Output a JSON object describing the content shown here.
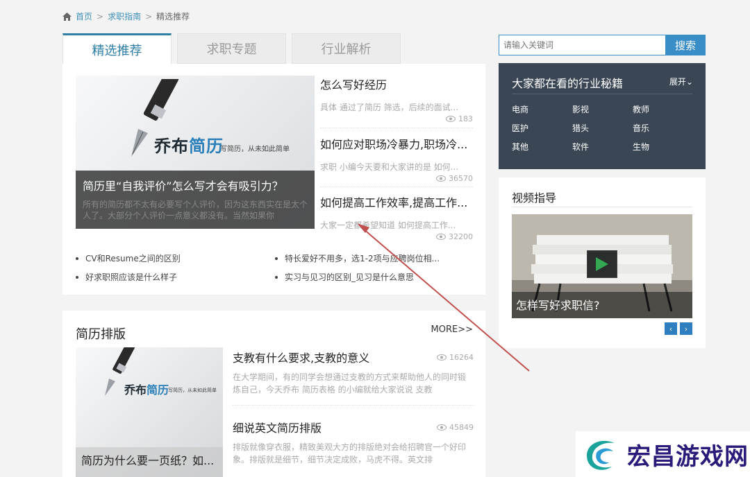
{
  "breadcrumb": {
    "home": "首页",
    "sep1": ">",
    "guide": "求职指南",
    "sep2": ">",
    "current": "精选推荐"
  },
  "tabs": [
    {
      "label": "精选推荐",
      "active": true
    },
    {
      "label": "求职专题",
      "active": false
    },
    {
      "label": "行业解析",
      "active": false
    }
  ],
  "featured": {
    "brand_part1": "乔布",
    "brand_part2": "简历",
    "brand_sub": "写简历，从未如此简单",
    "title": "简历里“自我评价”怎么写才会有吸引力？",
    "desc": "所有的简历都不太有必要写个人评价，因为这东西实在是太个人了。大部分个人评价一点意义都没有。当然如果你"
  },
  "articles": [
    {
      "title": "怎么写好经历",
      "desc": "具体 通过了简历 筛选，后续的面试...",
      "views": "183"
    },
    {
      "title": "如何应对职场冷暴力,职场冷...",
      "desc": "求职 小编今天要和大家讲的是 如何...",
      "views": "36570"
    },
    {
      "title": "如何提高工作效率,提高工作...",
      "desc": "大家一定都希望知道 如何提高工作...",
      "views": "32200"
    }
  ],
  "bullets": [
    "CV和Resume之间的区别",
    "特长爱好不用多，选1-2项与应聘岗位相...",
    "好求职照应该是什么样子",
    "实习与见习的区别_见习是什么意思"
  ],
  "resume_section": {
    "title": "简历排版",
    "more": "MORE>>",
    "brand_part1": "乔布",
    "brand_part2": "简历",
    "brand_sub": "写简历，从未如此简单",
    "feature_caption": "简历为什么要一页纸？如...",
    "articles": [
      {
        "title": "支教有什么要求,支教的意义",
        "views": "16264",
        "desc": "在大学期间，有的同学会想通过支教的方式来帮助他人的同时锻炼自己，今天乔布 简历表格 的小编就给大家说说 支教"
      },
      {
        "title": "细说英文简历排版",
        "views": "45849",
        "desc": "排版就像穿衣服，精致美观大方的排版绝对会给招聘官一个好印象。排版就是细节，细节决定成败，马虎不得。英文排"
      }
    ]
  },
  "search": {
    "placeholder": "请输入关键词",
    "button": "搜索"
  },
  "industry": {
    "title": "大家都在看的行业秘籍",
    "expand": "展开",
    "tags": [
      "电商",
      "影视",
      "教师",
      "医护",
      "猎头",
      "音乐",
      "其他",
      "软件",
      "生物"
    ]
  },
  "video": {
    "title": "视频指导",
    "caption": "怎样写好求职信?",
    "prev": "‹",
    "next": "›"
  },
  "watermark": {
    "text": "宏昌游戏网"
  },
  "colors": {
    "accent": "#2e7ea6",
    "search_button": "#3a8ec7",
    "sidebar_dark": "#3a4654",
    "arrow": "#c0504d"
  }
}
